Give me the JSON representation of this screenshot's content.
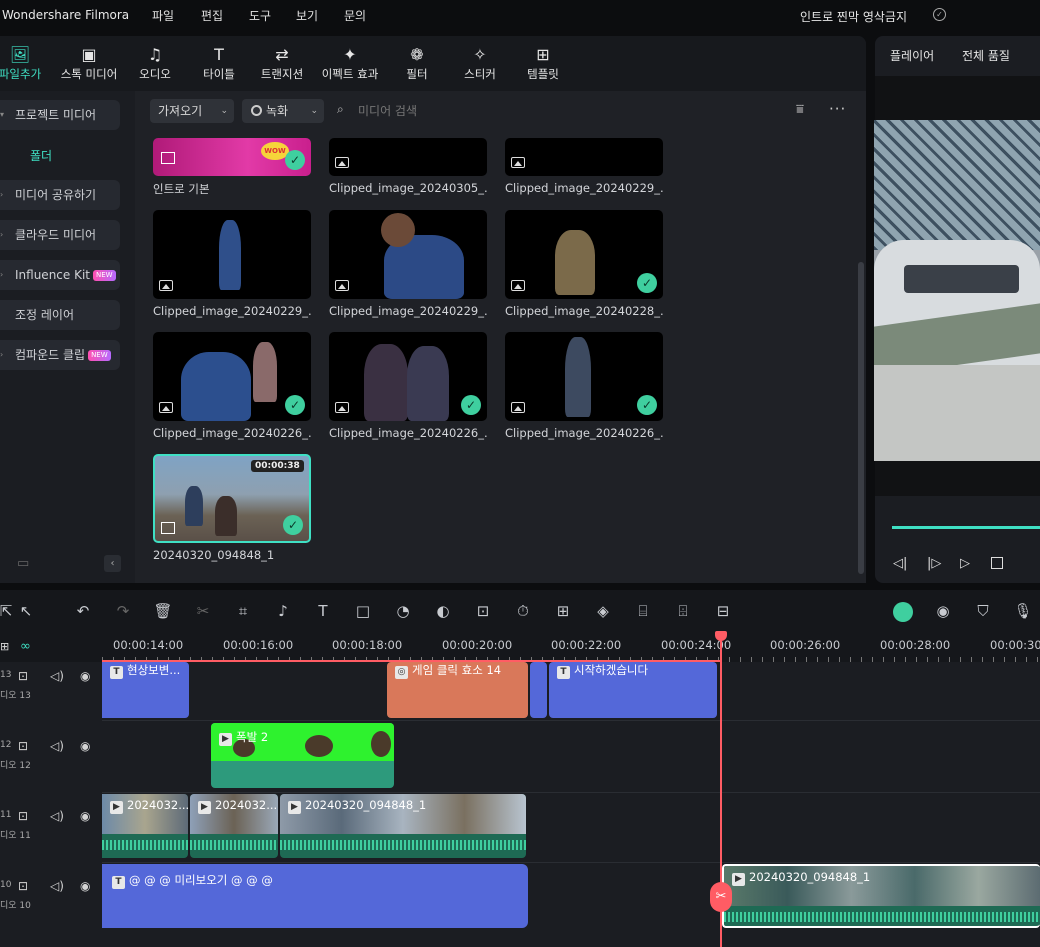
{
  "app": {
    "name": "Wondershare Filmora",
    "project": "인트로 찐막 영삭금지"
  },
  "menu": [
    "파일",
    "편집",
    "도구",
    "보기",
    "문의"
  ],
  "toptabs": [
    {
      "label": "파일추가",
      "icon": "media-icon"
    },
    {
      "label": "스톡 미디어",
      "icon": "stock-icon"
    },
    {
      "label": "오디오",
      "icon": "music-icon"
    },
    {
      "label": "타이틀",
      "icon": "title-icon"
    },
    {
      "label": "트랜지션",
      "icon": "transition-icon"
    },
    {
      "label": "이펙트 효과",
      "icon": "effects-icon"
    },
    {
      "label": "필터",
      "icon": "filter-icon"
    },
    {
      "label": "스티커",
      "icon": "sticker-icon"
    },
    {
      "label": "템플릿",
      "icon": "template-icon"
    }
  ],
  "sidebar": {
    "items": [
      {
        "label": "프로젝트 미디어"
      },
      {
        "label": "폴더"
      },
      {
        "label": "미디어 공유하기"
      },
      {
        "label": "클라우드 미디어"
      },
      {
        "label": "Influence Kit",
        "badge": "NEW"
      },
      {
        "label": "조정 레이어"
      },
      {
        "label": "컴파운드 클립",
        "badge": "NEW"
      }
    ]
  },
  "content": {
    "import_label": "가져오기",
    "record_label": "녹화",
    "search_placeholder": "미디어 검색",
    "cards": [
      {
        "label": "인트로 기본"
      },
      {
        "label": "Clipped_image_20240305_..."
      },
      {
        "label": "Clipped_image_20240229_..."
      },
      {
        "label": "Clipped_image_20240229_..."
      },
      {
        "label": "Clipped_image_20240229_..."
      },
      {
        "label": "Clipped_image_20240228_..."
      },
      {
        "label": "Clipped_image_20240226_..."
      },
      {
        "label": "Clipped_image_20240226_..."
      },
      {
        "label": "Clipped_image_20240226_..."
      },
      {
        "label": "20240320_094848_1",
        "duration": "00:00:38"
      }
    ]
  },
  "rightpanel": {
    "tab1": "플레이어",
    "tab2": "전체 품질"
  },
  "timeline": {
    "ticks": [
      "00:00:14:00",
      "00:00:16:00",
      "00:00:18:00",
      "00:00:20:00",
      "00:00:22:00",
      "00:00:24:00",
      "00:00:26:00",
      "00:00:28:00",
      "00:00:30:"
    ],
    "tracks": [
      {
        "num": "13",
        "sub": "디오 13"
      },
      {
        "num": "12",
        "sub": "디오 12"
      },
      {
        "num": "11",
        "sub": "디오 11"
      },
      {
        "num": "10",
        "sub": "디오 10"
      }
    ],
    "clips": {
      "t13a": "현상보변...",
      "t13b": "게임 클릭 효소 14",
      "t13c": "시작하겠습니다",
      "t12a": "폭발 2",
      "t11a": "2024032...",
      "t11b": "2024032...",
      "t11c": "20240320_094848_1",
      "t10a": "@ @ @ 미리보오기 @ @ @",
      "t10b": "20240320_094848_1"
    }
  },
  "colors": {
    "accent": "#3fe0c4",
    "title_clip": "#5468d9",
    "effect_clip": "#d9785a",
    "green_clip": "#2ef22e",
    "playhead": "#ff5c64"
  }
}
